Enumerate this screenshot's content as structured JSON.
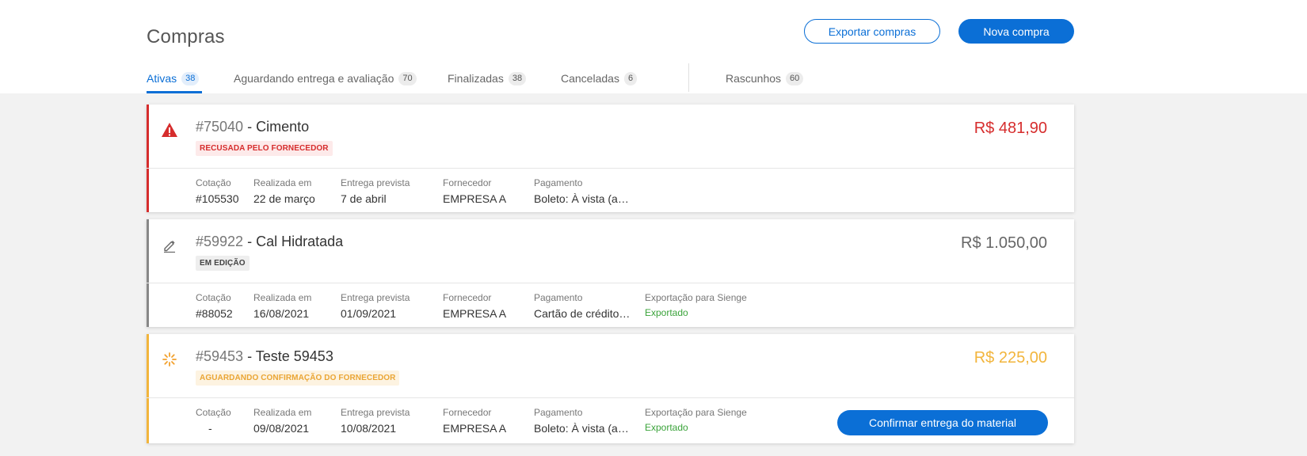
{
  "header": {
    "title": "Compras",
    "export_label": "Exportar compras",
    "new_label": "Nova compra"
  },
  "tabs": [
    {
      "label": "Ativas",
      "count": "38",
      "active": true
    },
    {
      "label": "Aguardando entrega e avaliação",
      "count": "70"
    },
    {
      "label": "Finalizadas",
      "count": "38"
    },
    {
      "label": "Canceladas",
      "count": "6"
    },
    {
      "label": "Rascunhos",
      "count": "60"
    }
  ],
  "field_labels": {
    "quote": "Cotação",
    "placed": "Realizada em",
    "delivery": "Entrega prevista",
    "supplier": "Fornecedor",
    "payment": "Pagamento",
    "export": "Exportação para Sienge"
  },
  "orders": [
    {
      "number": "#75040",
      "name": " - Cimento",
      "status": "RECUSADA PELO FORNECEDOR",
      "status_icon": "warning-icon",
      "color": "#d62d2d",
      "price": "R$ 481,90",
      "quote": "#105530",
      "placed": "22 de março",
      "delivery": "7 de abril",
      "supplier": "EMPRESA A",
      "payment": "Boleto: À vista (a…"
    },
    {
      "number": "#59922",
      "name": " - Cal Hidratada",
      "status": "EM EDIÇÃO",
      "status_icon": "pencil-icon",
      "color": "#777777",
      "price": "R$ 1.050,00",
      "quote": "#88052",
      "placed": "16/08/2021",
      "delivery": "01/09/2021",
      "supplier": "EMPRESA A",
      "payment": "Cartão de crédito…",
      "export": "Exportado"
    },
    {
      "number": "#59453",
      "name": " - Teste 59453",
      "status": "AGUARDANDO CONFIRMAÇÃO DO FORNECEDOR",
      "status_icon": "loading-spinner-icon",
      "color": "#f2b53c",
      "price": "R$ 225,00",
      "quote": "-",
      "placed": "09/08/2021",
      "delivery": "10/08/2021",
      "supplier": "EMPRESA A",
      "payment": "Boleto: À vista (a…",
      "export": "Exportado",
      "action_label": "Confirmar entrega do material"
    }
  ]
}
